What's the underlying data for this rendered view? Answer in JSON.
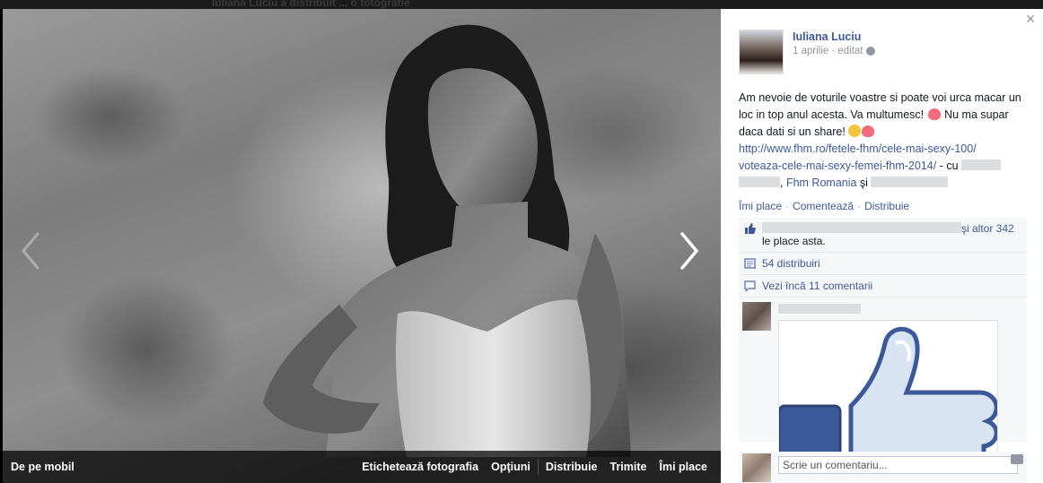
{
  "background": {
    "ghost_text": "Iuliana Luciu a distribuit ... o fotografie"
  },
  "photo_bar": {
    "mobile": "De pe mobil",
    "tag": "Etichetează fotografia",
    "options": "Opţiuni",
    "share": "Distribuie",
    "send": "Trimite",
    "like": "Îmi place"
  },
  "post": {
    "author": "Iuliana Luciu",
    "date": "1 aprilie",
    "edited": "· editat",
    "text_1": "Am nevoie de voturile voastre si poate voi urca macar un loc in top anul acesta. Va multumesc! ",
    "text_2": " Nu ma supar daca dati si un share! ",
    "link_1": "http://www.fhm.ro/fetele-fhm/cele-mai-sexy-100/",
    "link_2": "voteaza-cele-mai-sexy-femei-fhm-2014/",
    "with": " - cu ",
    "comma": ", ",
    "fhm": "Fhm Romania",
    "and": " şi "
  },
  "actions": {
    "like": "Îmi place",
    "comment": "Comentează",
    "share": "Distribuie"
  },
  "ufi": {
    "likes_tail": "şi altor 342",
    "likes_line2": "le place asta.",
    "shares": "54 distribuiri",
    "more_comments": "Vezi încă 11 comentarii"
  },
  "comment_box": {
    "placeholder": "Scrie un comentariu..."
  },
  "colors": {
    "link": "#3b5998",
    "panel_bg": "#ffffff",
    "ufi_bg": "#f6f7f8"
  }
}
